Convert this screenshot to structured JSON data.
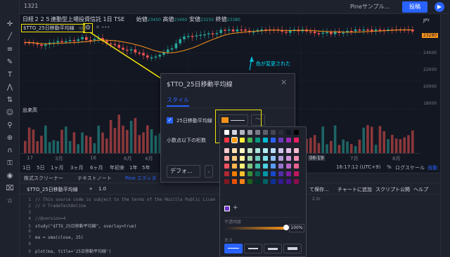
{
  "toolbar_top": {
    "symbol": "1321",
    "publish_label": "投稿",
    "script_label": "Pineサンプル...",
    "jpy": "JPY"
  },
  "legend": {
    "title": "日経２２５連動型上場投資信託 1日 TSE",
    "open_label": "始値",
    "open_value": "23450",
    "high_label": "高値",
    "high_value": "23460",
    "low_label": "安値",
    "low_value": "23250",
    "close_label": "終値",
    "close_value": "23380",
    "indicator_name": "$TTO_25日移動平均線",
    "volume_label": "出来高"
  },
  "price_scale": {
    "ticks": [
      "24000",
      "22000",
      "20000",
      "18000"
    ],
    "current": "23280"
  },
  "annotation": "色が変更された",
  "time_axis": [
    "17",
    "3月",
    "16",
    "6月",
    "4月",
    "7月",
    "8月"
  ],
  "time_badge": "06-19",
  "range_bar": {
    "items": [
      "1日",
      "5日",
      "1ヶ月",
      "3ヶ月",
      "6ヶ月",
      "年初来",
      "1年",
      "5年",
      "すべて"
    ],
    "clock": "16:17:12 (UTC+9)",
    "percent": "%",
    "log": "ログスケール",
    "auto": "自動"
  },
  "bottom_tabs": [
    "株式スクリーナー",
    "テキストノート",
    "Pine エディタ"
  ],
  "editor": {
    "title": "$TTO_25日移動平均線",
    "version": "1.0",
    "save_label": "て保存...",
    "add_label": "チャートに追加",
    "publish_label": "スクリプト公開",
    "help_label": "ヘルプ",
    "lines": [
      {
        "n": "1",
        "text": "// This source code is subject to the terms of the Mozilla Public Licen"
      },
      {
        "n": "2",
        "text": "// © TradeTechOnline"
      },
      {
        "n": "3",
        "text": ""
      },
      {
        "n": "4",
        "text": "//@version=4"
      },
      {
        "n": "5",
        "text": "study(\"$TTO_25日移動平均線\", overlay=true)"
      },
      {
        "n": "6",
        "text": ""
      },
      {
        "n": "7",
        "text": "ma = sma(close, 25)"
      },
      {
        "n": "8",
        "text": ""
      },
      {
        "n": "9",
        "text": "plot(ma, title='25日移動平均線')"
      }
    ],
    "license_tail": "2.0/"
  },
  "dialog": {
    "title": "$TTO_25日移動平均線",
    "tab": "スタイル",
    "checkbox_label": "25日移動平均線",
    "decimal_label": "小数点以下の桁数",
    "default_label": "デフォ..."
  },
  "picker": {
    "opacity_label": "不透明度",
    "opacity_value": "100%",
    "thickness_label": "太さ",
    "add": "+"
  },
  "colors": {
    "up": "#26a69a",
    "down": "#ef5350",
    "ma": "#f7931a",
    "accent": "#2962ff",
    "highlight": "#f5e60a"
  }
}
